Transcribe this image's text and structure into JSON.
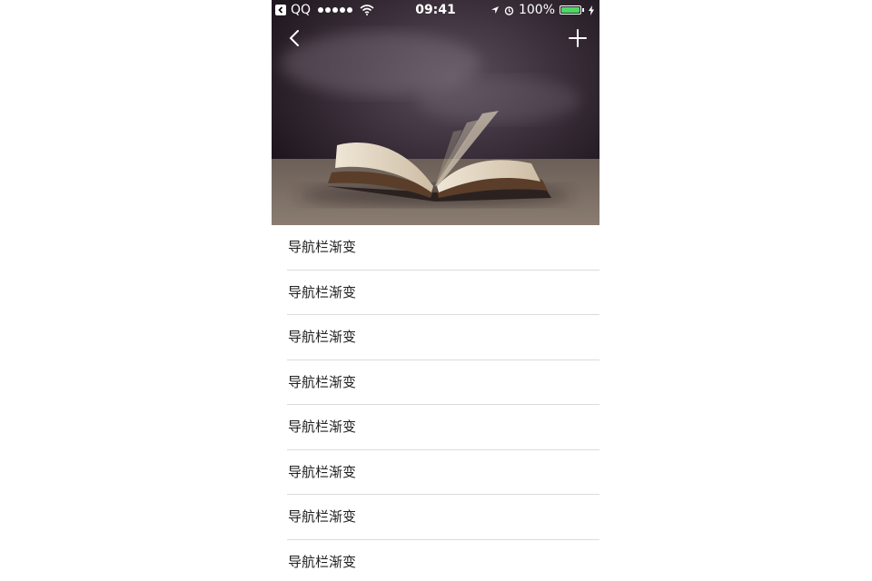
{
  "status_bar": {
    "app": "QQ",
    "time": "09:41",
    "battery": "100%",
    "battery_level": 1.0
  },
  "nav": {
    "back_icon": "chevron-left-icon",
    "add_icon": "plus-icon"
  },
  "list": {
    "items": [
      {
        "label": "导航栏渐变"
      },
      {
        "label": "导航栏渐变"
      },
      {
        "label": "导航栏渐变"
      },
      {
        "label": "导航栏渐变"
      },
      {
        "label": "导航栏渐变"
      },
      {
        "label": "导航栏渐变"
      },
      {
        "label": "导航栏渐变"
      },
      {
        "label": "导航栏渐变"
      }
    ]
  },
  "colors": {
    "battery": "#4cd964",
    "separator": "#dcdcdc",
    "text": "#222222"
  }
}
